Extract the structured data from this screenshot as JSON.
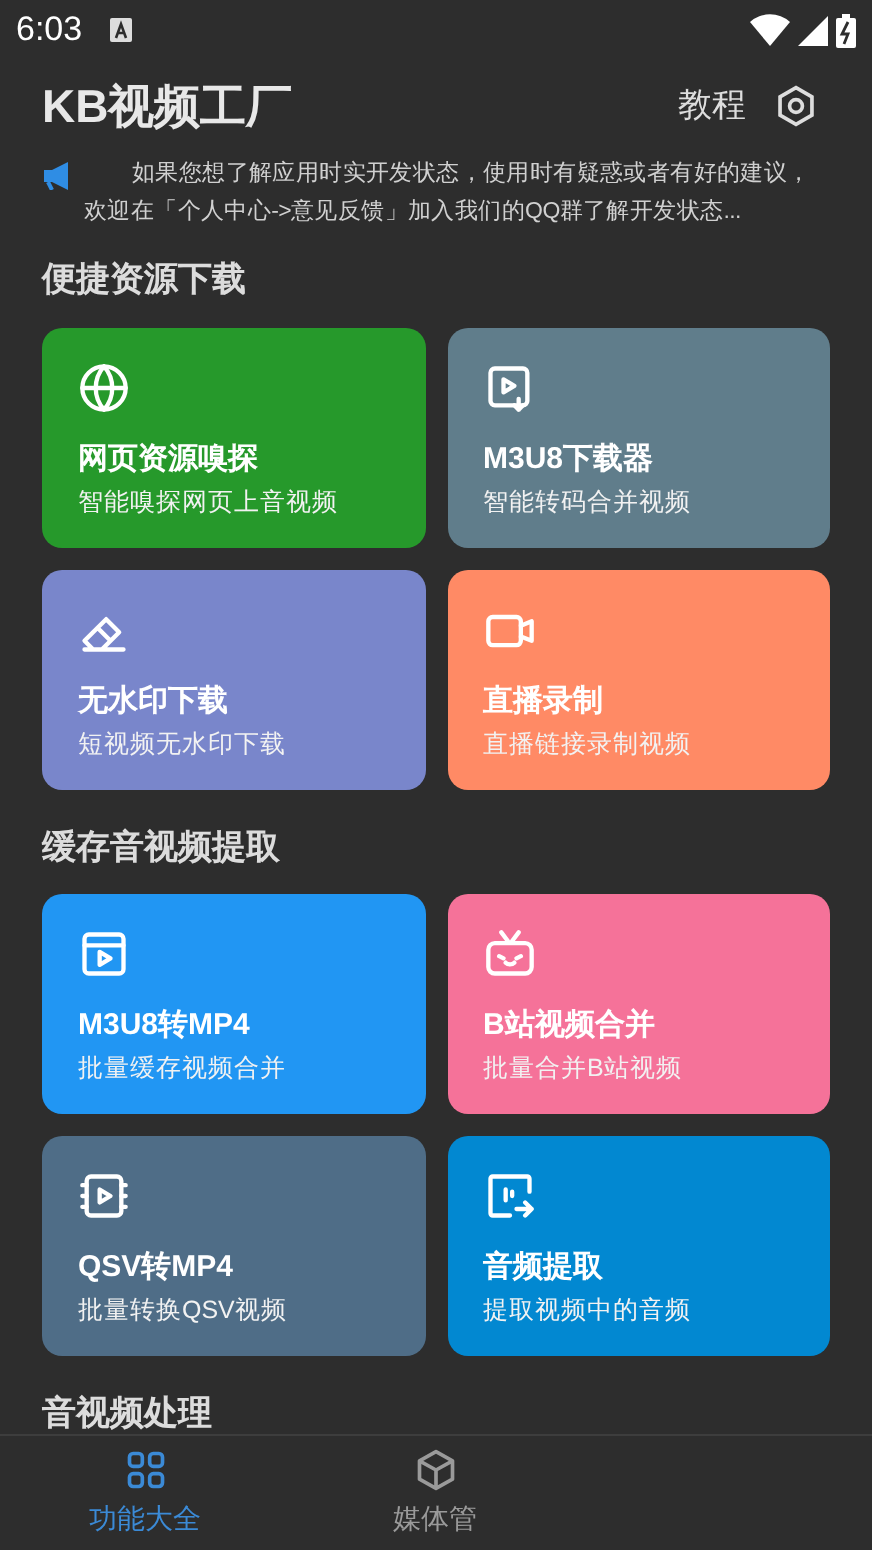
{
  "status_bar": {
    "time": "6:03"
  },
  "header": {
    "title": "KB视频工厂",
    "tutorial": "教程"
  },
  "notice": "如果您想了解应用时实开发状态，使用时有疑惑或者有好的建议，欢迎在「个人中心->意见反馈」加入我们的QQ群了解开发状态...",
  "sections": [
    {
      "title": "便捷资源下载",
      "cards": [
        {
          "title": "网页资源嗅探",
          "subtitle": "智能嗅探网页上音视频",
          "color": "#26992b"
        },
        {
          "title": "M3U8下载器",
          "subtitle": "智能转码合并视频",
          "color": "#607d8b"
        },
        {
          "title": "无水印下载",
          "subtitle": "短视频无水印下载",
          "color": "#7986cb"
        },
        {
          "title": "直播录制",
          "subtitle": "直播链接录制视频",
          "color": "#ff8a65"
        }
      ]
    },
    {
      "title": "缓存音视频提取",
      "cards": [
        {
          "title": "M3U8转MP4",
          "subtitle": "批量缓存视频合并",
          "color": "#2196f3"
        },
        {
          "title": "B站视频合并",
          "subtitle": "批量合并B站视频",
          "color": "#f57299"
        },
        {
          "title": "QSV转MP4",
          "subtitle": "批量转换QSV视频",
          "color": "#4f6d87"
        },
        {
          "title": "音频提取",
          "subtitle": "提取视频中的音频",
          "color": "#0288d1"
        }
      ]
    },
    {
      "title": "音视频处理"
    }
  ],
  "bottom_nav": [
    {
      "label": "功能大全",
      "selected": true
    },
    {
      "label": "媒体管",
      "selected": false
    }
  ]
}
